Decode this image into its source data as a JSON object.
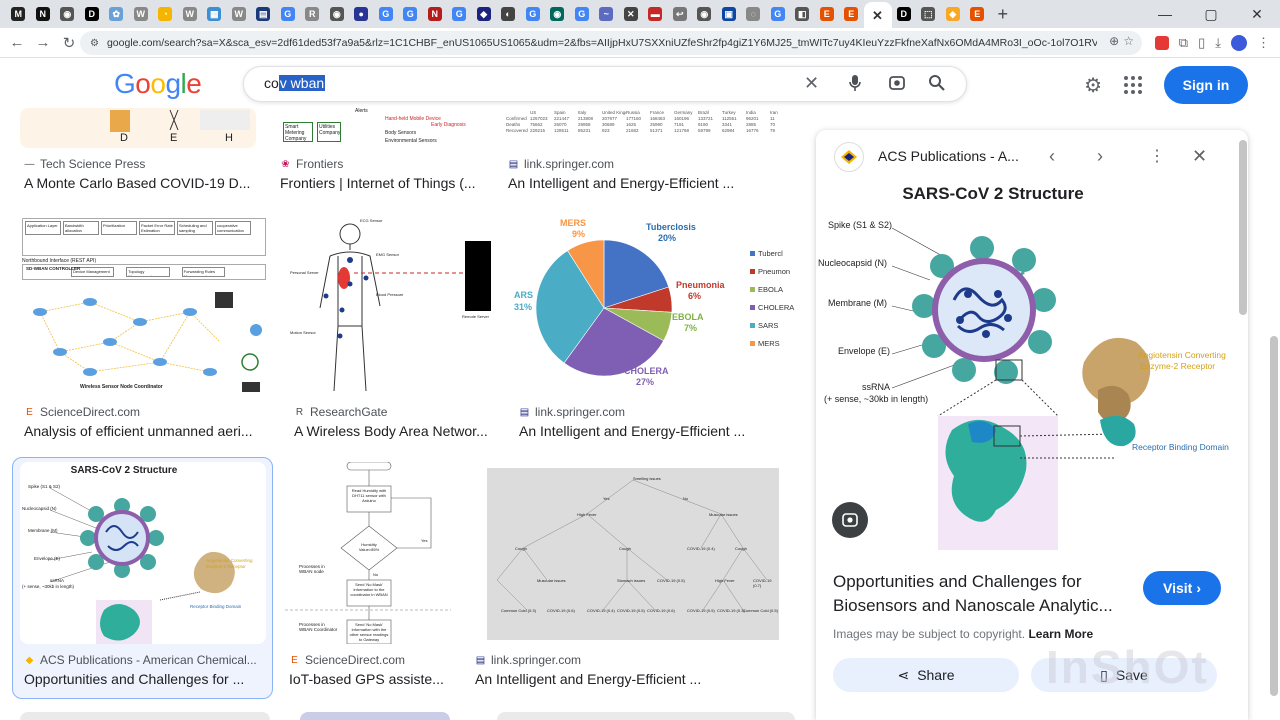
{
  "browser": {
    "tab_favicons": [
      {
        "glyph": "M",
        "bg": "#222"
      },
      {
        "glyph": "N",
        "bg": "#111"
      },
      {
        "glyph": "◉",
        "bg": "#555"
      },
      {
        "glyph": "D",
        "bg": "#000"
      },
      {
        "glyph": "✿",
        "bg": "#6aa0d8"
      },
      {
        "glyph": "W",
        "bg": "#888"
      },
      {
        "glyph": "◔",
        "bg": "#f4b400"
      },
      {
        "glyph": "W",
        "bg": "#888"
      },
      {
        "glyph": "▦",
        "bg": "#3d8fd1"
      },
      {
        "glyph": "W",
        "bg": "#888"
      },
      {
        "glyph": "▤",
        "bg": "#1a3a7a"
      },
      {
        "glyph": "G",
        "bg": "#4285f4"
      },
      {
        "glyph": "R",
        "bg": "#888"
      },
      {
        "glyph": "◉",
        "bg": "#555"
      },
      {
        "glyph": "●",
        "bg": "#283593"
      },
      {
        "glyph": "G",
        "bg": "#4285f4"
      },
      {
        "glyph": "G",
        "bg": "#4285f4"
      },
      {
        "glyph": "N",
        "bg": "#b71c1c"
      },
      {
        "glyph": "G",
        "bg": "#4285f4"
      },
      {
        "glyph": "◆",
        "bg": "#1a237e"
      },
      {
        "glyph": "◐",
        "bg": "#444"
      },
      {
        "glyph": "G",
        "bg": "#4285f4"
      },
      {
        "glyph": "◉",
        "bg": "#00695c"
      },
      {
        "glyph": "G",
        "bg": "#4285f4"
      },
      {
        "glyph": "~",
        "bg": "#5c6bc0"
      },
      {
        "glyph": "✕",
        "bg": "#444"
      },
      {
        "glyph": "▬",
        "bg": "#c62828"
      },
      {
        "glyph": "↩",
        "bg": "#777"
      },
      {
        "glyph": "◉",
        "bg": "#555"
      },
      {
        "glyph": "▣",
        "bg": "#0d47a1"
      },
      {
        "glyph": "◌",
        "bg": "#888"
      },
      {
        "glyph": "G",
        "bg": "#4285f4"
      },
      {
        "glyph": "◧",
        "bg": "#555"
      },
      {
        "glyph": "E",
        "bg": "#e65100"
      },
      {
        "glyph": "E",
        "bg": "#e65100"
      }
    ],
    "active_tab_glyph": "✕",
    "tabs_after": [
      {
        "glyph": "D",
        "bg": "#000"
      },
      {
        "glyph": "⬚",
        "bg": "#555"
      },
      {
        "glyph": "◆",
        "bg": "#f9a825"
      },
      {
        "glyph": "E",
        "bg": "#e65100"
      }
    ],
    "new_tab": "+",
    "window_controls": [
      "—",
      "▢",
      "✕"
    ],
    "url": "google.com/search?sa=X&sca_esv=2df61ded53f7a9a5&rlz=1C1CHBF_enUS1065US1065&udm=2&fbs=AIIjpHxU7SXXniUZfeShr2fp4giZ1Y6MJ25_tmWITc7uy4KIeuYzzFkfneXafNx6OMdA4MRo3I_oOc-1ol7O1RV73dx3MlyCigtuiU2aDjExlvydX..."
  },
  "google": {
    "logo": [
      "G",
      "o",
      "o",
      "g",
      "l",
      "e"
    ],
    "query_prefix": "co",
    "query_selected": "v wban",
    "signin_label": "Sign in"
  },
  "results": [
    {
      "source": "Tech Science Press",
      "title": "A Monte Carlo Based COVID-19 D...",
      "icon": "—"
    },
    {
      "source": "Frontiers",
      "title": "Frontiers | Internet of Things (...",
      "icon": "❀"
    },
    {
      "source": "link.springer.com",
      "title": "An Intelligent and Energy-Efficient ...",
      "icon": "▤"
    },
    {
      "source": "ScienceDirect.com",
      "title": "Analysis of efficient unmanned aeri...",
      "icon": "E"
    },
    {
      "source": "ResearchGate",
      "title": "A Wireless Body Area Networ...",
      "icon": "R"
    },
    {
      "source": "link.springer.com",
      "title": "An Intelligent and Energy-Efficient ...",
      "icon": "▤"
    },
    {
      "source": "ACS Publications - American Chemical...",
      "title": "Opportunities and Challenges for ...",
      "icon": "◆"
    },
    {
      "source": "ScienceDirect.com",
      "title": "IoT-based GPS assiste...",
      "icon": "E"
    },
    {
      "source": "link.springer.com",
      "title": "An Intelligent and Energy-Efficient ...",
      "icon": "▤"
    }
  ],
  "pie": {
    "labels": [
      {
        "name": "Tuberclosis",
        "pct": "20%",
        "color": "#4472c4"
      },
      {
        "name": "Pneumonia",
        "pct": "6%",
        "color": "#c0392b"
      },
      {
        "name": "EBOLA",
        "pct": "7%",
        "color": "#9bbb59"
      },
      {
        "name": "CHOLERA",
        "pct": "27%",
        "color": "#7f5fb3"
      },
      {
        "name": "SARS",
        "pct": "31%",
        "color": "#4bacc6"
      },
      {
        "name": "MERS",
        "pct": "9%",
        "color": "#f79646"
      }
    ],
    "legend": [
      "Tubercl",
      "Pneumon",
      "EBOLA",
      "CHOLERA",
      "SARS",
      "MERS"
    ],
    "ars_label": "ARS",
    "ars_pct": "31%"
  },
  "thumb_texts": {
    "sars_title": "SARS-CoV 2 Structure",
    "wban_top": [
      "Application Layer",
      "Bandwidth allocation",
      "Prioritization",
      "Packet Error Rate Estimation",
      "Scheduling and sampling management",
      "cooperative communication management"
    ],
    "wban_mid": [
      "Device Management",
      "Topology Management",
      "Forwarding Rules Management"
    ],
    "wban_north": "Northbound Interface (REST API)",
    "wban_ctrl": "SD-WBAN CONTROLLER",
    "wban_footer": "Wireless Sensor Node Coordinator",
    "body_sensors": [
      "ECG Sensor",
      "EMG Sensor",
      "Blood Pressure",
      "Personal Server",
      "Motion Sensor",
      "Remote Server"
    ],
    "flow": [
      "Read Humidity with DHT11 sensor with Arduino",
      "Humidity Value>85%",
      "Yes",
      "No",
      "Send 'No Mask' information to the coordinator in WBAN",
      "Send 'No Mask' information with the other sensor readings to Gateway",
      "Processes in WBAN node",
      "Processes in WBAN Coordinator"
    ],
    "tree": [
      "Smelling issues",
      "High Fever",
      "Muscular issues",
      "Cough",
      "Cough",
      "COVID-19 (0.4)",
      "Cough",
      "Muscular issues",
      "Stomach issues",
      "COVID-19 (0.5)",
      "High Fever",
      "COVID-19 (0.7)",
      "Common Cold (0.3)",
      "COVID-19 (0.6)",
      "COVID-19 (0.4)",
      "COVID-19 (0.5)",
      "COVID-19 (0.6)",
      "COVID-19 (0.5)",
      "COVID-19 (0.3)",
      "Common Cold (0.5)",
      "Yes",
      "No"
    ],
    "top_row_1": [
      "D",
      "E",
      "H"
    ],
    "top_row_2": [
      "Smart Metering Company",
      "Utilities Company",
      "Alerts",
      "Hand-held Mobile Device",
      "Body Sensors",
      "Environmental Sensors",
      "Early Diagnosis"
    ],
    "table_cols": [
      "US",
      "Spain",
      "Italy",
      "United Kingdom",
      "Russia",
      "France",
      "Germany",
      "Brazil",
      "Turkey",
      "India",
      "Iran"
    ],
    "table_r1": [
      "Confirmed",
      "1257023",
      "221447",
      "213808",
      "207977",
      "177160",
      "168483",
      "160196",
      "133721",
      "112551",
      "96201",
      "11"
    ],
    "table_r2": [
      "Deaths",
      "75662",
      "26070",
      "29958",
      "30689",
      "1625",
      "25990",
      "7191",
      "9190",
      "3341",
      "2885",
      "70"
    ],
    "table_r3": [
      "Recovered",
      "229215",
      "128511",
      "85231",
      "923",
      "21682",
      "51371",
      "121768",
      "59799",
      "62984",
      "16776",
      "79"
    ]
  },
  "panel": {
    "source_name": "ACS Publications - A...",
    "title": "SARS-CoV 2 Structure",
    "labels_left": [
      "Spike (S1 & S2)",
      "Nucleocapsid (N)",
      "Membrane (M)",
      "Envelope (E)",
      "ssRNA",
      "(+ sense, ~30kb in length)"
    ],
    "labels_right": [
      "Angiotensin Converting",
      "Enzyme-2 Receptor",
      "Receptor Binding Domain"
    ],
    "headline": "Opportunities and Challenges for Biosensors and Nanoscale Analytic...",
    "visit_label": "Visit",
    "copyright": "Images may be subject to copyright.",
    "learn_more": "Learn More",
    "share_label": "Share",
    "save_label": "Save"
  },
  "watermark": "InShOt",
  "colors": {
    "accent": "#1a73e8",
    "selected_bg": "#eef3fd"
  }
}
